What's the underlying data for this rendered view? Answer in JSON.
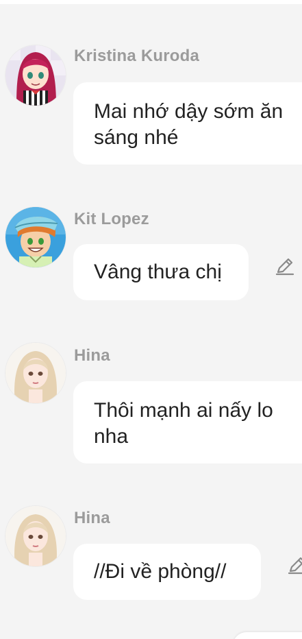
{
  "messages": [
    {
      "sender": "Kristina Kuroda",
      "text": "Mai nhớ dậy sớm ăn sáng nhé",
      "avatar_icon": "anime-girl-red-hair-avatar",
      "editable": false
    },
    {
      "sender": "Kit Lopez",
      "text": "Vâng thưa chị",
      "avatar_icon": "anime-boy-cap-avatar",
      "editable": true
    },
    {
      "sender": "Hina",
      "text": "Thôi mạnh ai nấy lo nha",
      "avatar_icon": "blonde-girl-avatar",
      "editable": false
    },
    {
      "sender": "Hina",
      "text": "//Đi về phòng//",
      "avatar_icon": "blonde-girl-avatar",
      "editable": true
    }
  ],
  "colors": {
    "background": "#f4f4f4",
    "bubble": "#ffffff",
    "sender_name": "#9b9b9b",
    "message_text": "#222222",
    "icon": "#8a8a8a"
  }
}
